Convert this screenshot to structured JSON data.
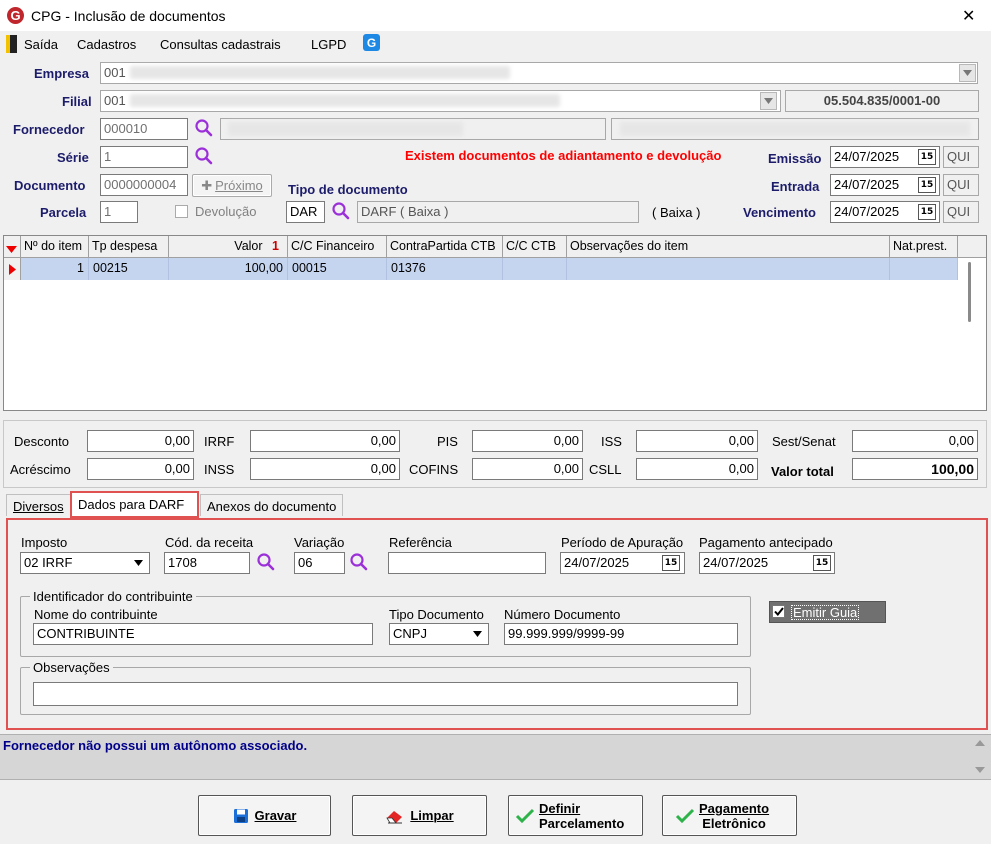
{
  "window": {
    "title": "CPG - Inclusão de documentos",
    "close": "✕"
  },
  "menu": {
    "items": [
      "Saída",
      "Cadastros",
      "Consultas cadastrais",
      "LGPD"
    ]
  },
  "header": {
    "empresa_label": "Empresa",
    "empresa_value": "001",
    "filial_label": "Filial",
    "filial_value": "001",
    "cnpj": "05.504.835/0001-00",
    "fornecedor_label": "Fornecedor",
    "fornecedor_value": "000010",
    "serie_label": "Série",
    "serie_value": "1",
    "documento_label": "Documento",
    "documento_value": "0000000004",
    "proximo_label": "Próximo",
    "parcela_label": "Parcela",
    "parcela_value": "1",
    "devolucao_label": "Devolução",
    "tipo_doc_label": "Tipo de documento",
    "tipo_doc_code": "DAR",
    "tipo_doc_desc": "DARF ( Baixa )",
    "tipo_doc_suffix": "( Baixa )",
    "warning": "Existem documentos de adiantamento e devolução",
    "emissao_label": "Emissão",
    "emissao_value": "24/07/2025",
    "emissao_day": "QUI",
    "entrada_label": "Entrada",
    "entrada_value": "24/07/2025",
    "entrada_day": "QUI",
    "vencimento_label": "Vencimento",
    "vencimento_value": "24/07/2025",
    "vencimento_day": "QUI"
  },
  "grid": {
    "columns": [
      "Nº do item",
      "Tp despesa",
      "Valor",
      "C/C Financeiro",
      "ContraPartida CTB",
      "C/C CTB",
      "Observações do item",
      "Nat.prest."
    ],
    "sort_marker": "1",
    "rows": [
      {
        "item": "1",
        "tp_despesa": "00215",
        "valor": "100,00",
        "cc_fin": "00015",
        "contrapartida": "01376",
        "cc_ctb": "",
        "obs": "",
        "nat": ""
      }
    ]
  },
  "totals": {
    "desconto_label": "Desconto",
    "desconto": "0,00",
    "irrf_label": "IRRF",
    "irrf": "0,00",
    "pis_label": "PIS",
    "pis": "0,00",
    "iss_label": "ISS",
    "iss": "0,00",
    "sest_label": "Sest/Senat",
    "sest": "0,00",
    "acrescimo_label": "Acréscimo",
    "acrescimo": "0,00",
    "inss_label": "INSS",
    "inss": "0,00",
    "cofins_label": "COFINS",
    "cofins": "0,00",
    "csll_label": "CSLL",
    "csll": "0,00",
    "valor_total_label": "Valor total",
    "valor_total": "100,00"
  },
  "tabs": [
    "Diversos",
    "Dados para DARF",
    "Anexos do documento"
  ],
  "darf": {
    "imposto_label": "Imposto",
    "imposto_value": "02 IRRF",
    "receita_label": "Cód. da receita",
    "receita_value": "1708",
    "variacao_label": "Variação",
    "variacao_value": "06",
    "referencia_label": "Referência",
    "referencia_value": "",
    "periodo_label": "Período de Apuração",
    "periodo_value": "24/07/2025",
    "pagamento_label": "Pagamento antecipado",
    "pagamento_value": "24/07/2025",
    "ident_legend": "Identificador do contribuinte",
    "nome_label": "Nome do contribuinte",
    "nome_value": "CONTRIBUINTE",
    "tipo_label": "Tipo Documento",
    "tipo_value": "CNPJ",
    "numero_label": "Número Documento",
    "numero_value": "99.999.999/9999-99",
    "emitir_label": "Emitir Guia",
    "obs_legend": "Observações",
    "obs_value": ""
  },
  "status": {
    "message": "Fornecedor não possui um autônomo associado."
  },
  "buttons": {
    "gravar": "Gravar",
    "limpar": "Limpar",
    "definir_1": "Definir",
    "definir_2": "Parcelamento",
    "pagamento_1": "Pagamento",
    "pagamento_2": "Eletrônico"
  },
  "colors": {
    "accent_red": "#d9342b",
    "warning_red": "#ff0000",
    "label_blue": "#1c1c6b",
    "status_blue": "#00008b",
    "selected_row": "#c5d5ef"
  }
}
